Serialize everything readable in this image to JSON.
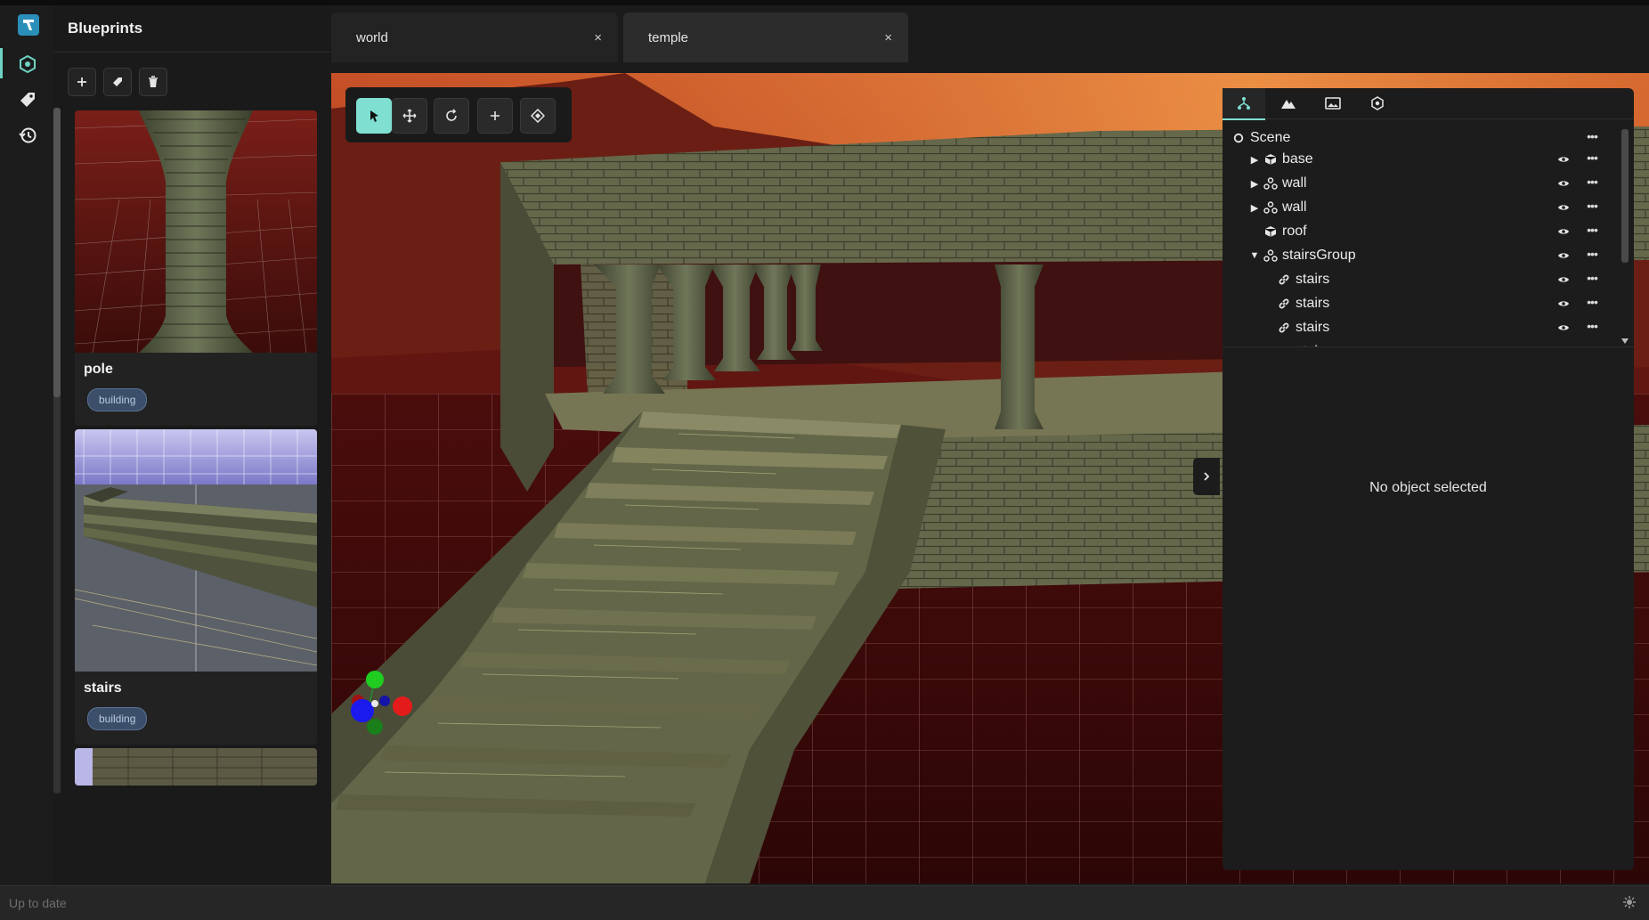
{
  "sidebar": {
    "title": "Blueprints",
    "actions": [
      "add",
      "tag",
      "delete"
    ],
    "cards": [
      {
        "name": "pole",
        "tag": "building"
      },
      {
        "name": "stairs",
        "tag": "building"
      }
    ]
  },
  "tabs": [
    {
      "label": "world",
      "close": "×"
    },
    {
      "label": "temple",
      "close": "×"
    }
  ],
  "toolbar": {
    "tools": [
      "select-icon",
      "move-icon",
      "rotate-icon",
      "add-icon",
      "snap-icon"
    ],
    "active": "select-icon"
  },
  "outliner": {
    "tabs": [
      "hierarchy-icon",
      "terrain-icon",
      "image-icon",
      "asset-icon"
    ],
    "scene_label": "Scene",
    "items": [
      {
        "label": "base",
        "type": "mesh",
        "expandable": true,
        "expanded": false
      },
      {
        "label": "wall",
        "type": "group",
        "expandable": true,
        "expanded": false
      },
      {
        "label": "wall",
        "type": "group",
        "expandable": true,
        "expanded": false
      },
      {
        "label": "roof",
        "type": "mesh",
        "expandable": false
      },
      {
        "label": "stairsGroup",
        "type": "group",
        "expandable": true,
        "expanded": true
      },
      {
        "label": "stairs",
        "type": "link"
      },
      {
        "label": "stairs",
        "type": "link"
      },
      {
        "label": "stairs",
        "type": "link"
      },
      {
        "label": "stairs",
        "type": "link"
      }
    ],
    "empty_text": "No object selected"
  },
  "status": {
    "text": "Up to date"
  },
  "colors": {
    "accent": "#7fe0d2",
    "tag_bg": "#3b4f6a",
    "sky_orange": "#e07a35"
  }
}
